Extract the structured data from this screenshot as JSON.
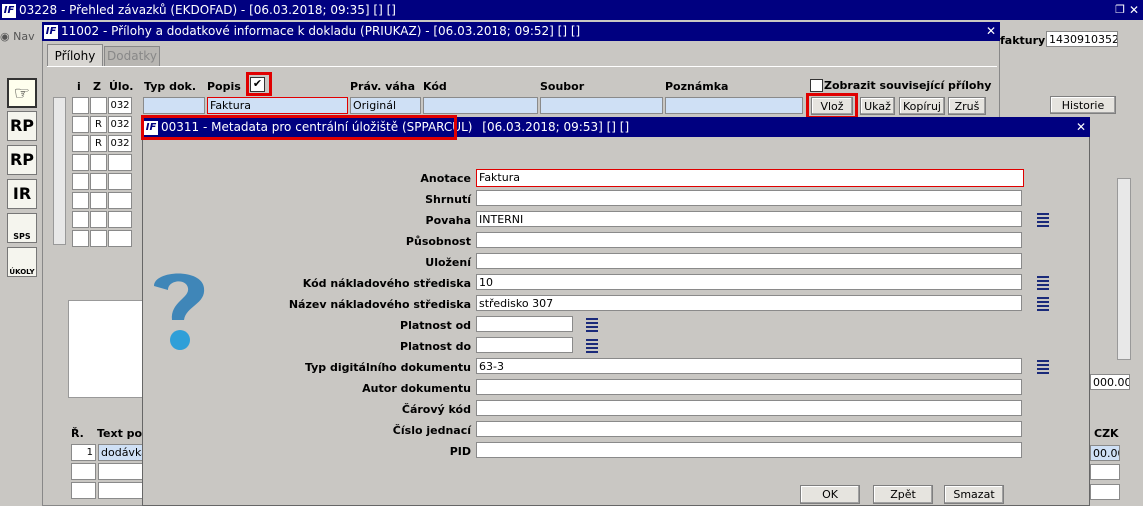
{
  "main_window": {
    "title": "03228 - Přehled závazků (EKDOFAD) - [06.03.2018; 09:35] [] []",
    "nav_label": "Nav",
    "faktury_label": "faktury",
    "faktury_value": "1430910352",
    "historie_button": "Historie",
    "amount_right": "000.00",
    "czk_label": "CZK",
    "czk_value": "00.00",
    "lines_header": {
      "r": "Ř.",
      "text": "Text pol"
    },
    "line1": {
      "num": "1",
      "text": "dodávka_"
    }
  },
  "toolbar": [
    "RP",
    "RP",
    "IR",
    "SPS",
    "ÚKOLY"
  ],
  "attach_window": {
    "title": "11002 - Přílohy a dodatkové informace k dokladu (PRIUKAZ) - [06.03.2018; 09:52] [] []",
    "tab_active": "Přílohy",
    "tab_inactive": "Dodatky",
    "columns": {
      "i": "i",
      "z": "Z",
      "ulo": "Úlo.",
      "typ": "Typ dok.",
      "popis": "Popis",
      "prav": "Práv. váha",
      "kod": "Kód",
      "soubor": "Soubor",
      "poznamka": "Poznámka"
    },
    "checkbox_label": "Zobrazit související přílohy",
    "row1": {
      "ulo": "032",
      "popis": "Faktura",
      "prav": "Originál"
    },
    "row2": {
      "z": "R",
      "ulo": "032"
    },
    "row3": {
      "z": "R",
      "ulo": "032"
    },
    "buttons": {
      "vloz": "Vlož",
      "ukaz": "Ukaž",
      "kopiruj": "Kopíruj",
      "zrus": "Zruš"
    }
  },
  "meta_dialog": {
    "title_main": "00311 - Metadata pro centrální úložiště (SPPARCUL)",
    "title_rest": "[06.03.2018; 09:53] [] []",
    "fields": {
      "anotace": {
        "label": "Anotace",
        "value": "Faktura"
      },
      "shrnuti": {
        "label": "Shrnutí",
        "value": ""
      },
      "povaha": {
        "label": "Povaha",
        "value": "INTERNI"
      },
      "pusobnost": {
        "label": "Působnost",
        "value": ""
      },
      "ulozeni": {
        "label": "Uložení",
        "value": ""
      },
      "kod_ns": {
        "label": "Kód nákladového střediska",
        "value": "10"
      },
      "nazev_ns": {
        "label": "Název nákladového střediska",
        "value": "středisko 307"
      },
      "platnost_od": {
        "label": "Platnost od",
        "value": ""
      },
      "platnost_do": {
        "label": "Platnost do",
        "value": ""
      },
      "typ_dig": {
        "label": "Typ digitálního dokumentu",
        "value": "63-3"
      },
      "autor": {
        "label": "Autor dokumentu",
        "value": ""
      },
      "carovy": {
        "label": "Čárový kód",
        "value": ""
      },
      "cislo": {
        "label": "Číslo jednací",
        "value": ""
      },
      "pid": {
        "label": "PID",
        "value": ""
      }
    },
    "buttons": {
      "ok": "OK",
      "zpet": "Zpět",
      "smazat": "Smazat"
    }
  }
}
